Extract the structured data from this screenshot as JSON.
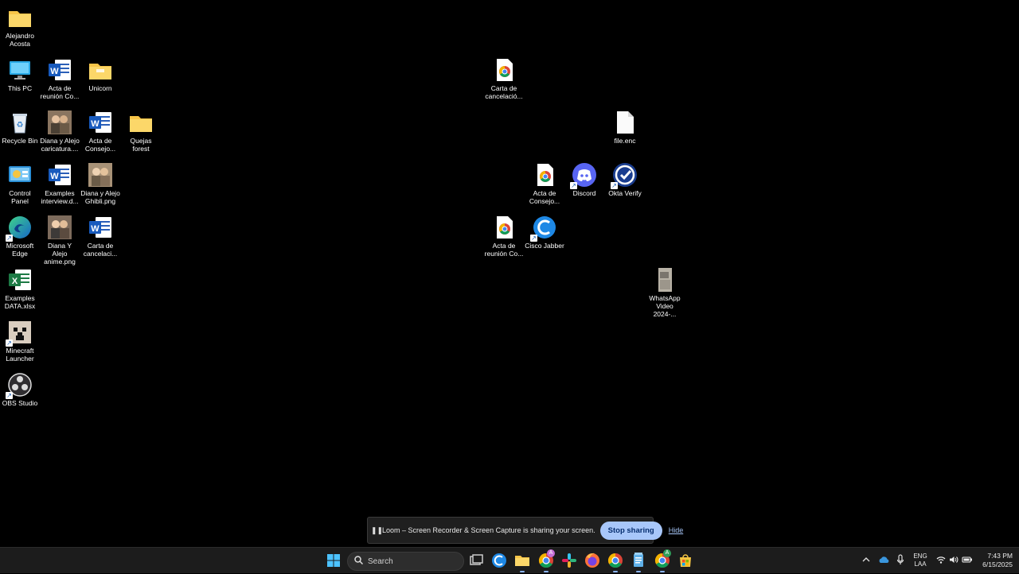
{
  "desktop": {
    "icons": [
      {
        "id": "alejandro-acosta",
        "label": "Alejandro Acosta"
      },
      {
        "id": "this-pc",
        "label": "This PC"
      },
      {
        "id": "acta-reunion-word",
        "label": "Acta de reunión Co..."
      },
      {
        "id": "unicorn",
        "label": "Unicorn"
      },
      {
        "id": "recycle-bin",
        "label": "Recycle Bin"
      },
      {
        "id": "diana-alejo-caricatura",
        "label": "Diana y Alejo caricatura...."
      },
      {
        "id": "acta-consejo-word",
        "label": "Acta de Consejo..."
      },
      {
        "id": "quejas-forest",
        "label": "Quejas forest"
      },
      {
        "id": "control-panel",
        "label": "Control Panel"
      },
      {
        "id": "examples-interview",
        "label": "Examples interview.d..."
      },
      {
        "id": "diana-alejo-ghibli",
        "label": "Diana y Alejo Ghibli.png"
      },
      {
        "id": "microsoft-edge",
        "label": "Microsoft Edge"
      },
      {
        "id": "diana-alejo-anime",
        "label": "Diana Y Alejo anime.png"
      },
      {
        "id": "carta-cancelacion-word",
        "label": "Carta de cancelaci..."
      },
      {
        "id": "examples-data",
        "label": "Examples DATA.xlsx"
      },
      {
        "id": "minecraft-launcher",
        "label": "Minecraft Launcher"
      },
      {
        "id": "obs-studio",
        "label": "OBS Studio"
      },
      {
        "id": "carta-cancelacion-chrome",
        "label": "Carta de cancelació..."
      },
      {
        "id": "file-enc",
        "label": "file.enc"
      },
      {
        "id": "acta-consejo-chrome",
        "label": "Acta de Consejo..."
      },
      {
        "id": "discord",
        "label": "Discord"
      },
      {
        "id": "okta-verify",
        "label": "Okta Verify"
      },
      {
        "id": "acta-reunion-chrome",
        "label": "Acta de reunión Co..."
      },
      {
        "id": "cisco-jabber",
        "label": "Cisco Jabber"
      },
      {
        "id": "whatsapp-video",
        "label": "WhatsApp Video 2024-..."
      }
    ]
  },
  "loom": {
    "pause_icon": "pause-icon",
    "message": "Loom – Screen Recorder & Screen Capture is sharing your screen.",
    "stop_label": "Stop sharing",
    "hide_label": "Hide"
  },
  "taskbar": {
    "search_placeholder": "Search",
    "language_top": "ENG",
    "language_bottom": "LAA",
    "time": "7:43 PM",
    "date": "6/15/2025",
    "chrome_badge": "A"
  },
  "colors": {
    "accent": "#a8c7fa",
    "taskbar": "#1c1c1c",
    "folder": "#f8c548"
  }
}
